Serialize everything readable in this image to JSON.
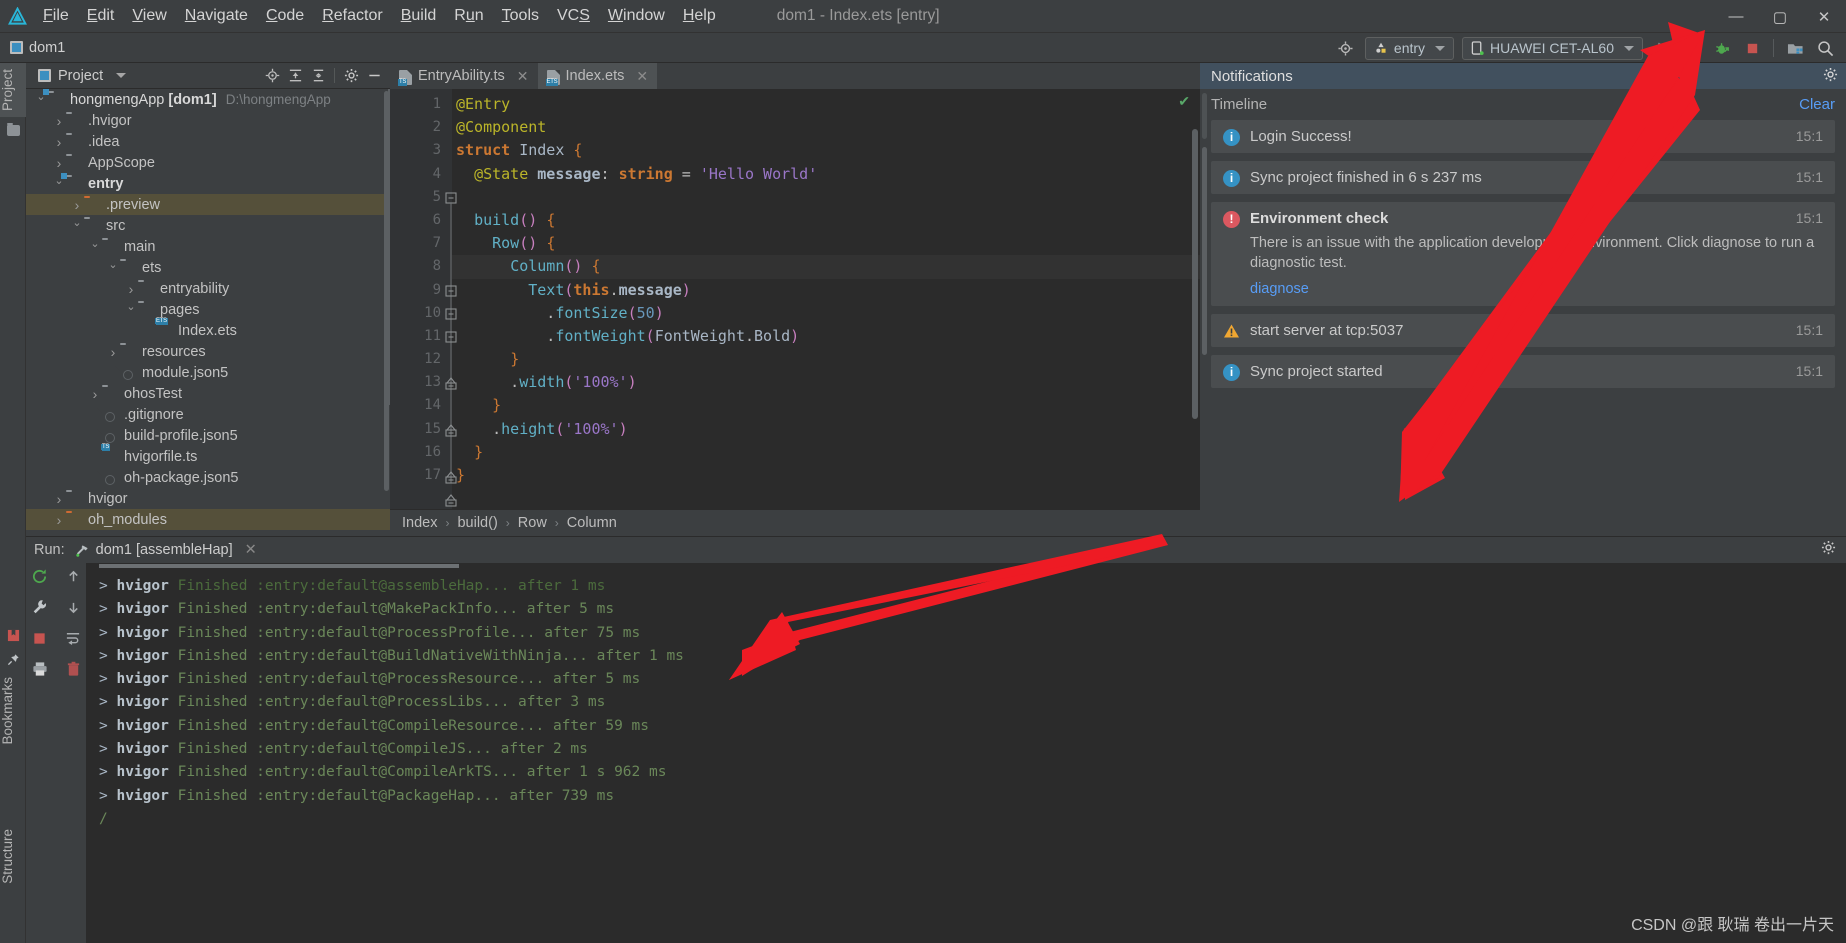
{
  "window": {
    "title": "dom1 - Index.ets [entry]",
    "minimize": "—",
    "maximize": "▢",
    "close": "✕"
  },
  "menubar": {
    "logo_icon": "deveco-logo-icon",
    "items": [
      {
        "label": "File"
      },
      {
        "label": "Edit"
      },
      {
        "label": "View"
      },
      {
        "label": "Navigate"
      },
      {
        "label": "Code"
      },
      {
        "label": "Refactor"
      },
      {
        "label": "Build"
      },
      {
        "label": "Run"
      },
      {
        "label": "Tools"
      },
      {
        "label": "VCS"
      },
      {
        "label": "Window"
      },
      {
        "label": "Help"
      }
    ]
  },
  "toolbar": {
    "project_label": "dom1",
    "target_icon": "target-icon",
    "run_config": "entry",
    "device": "HUAWEI CET-AL60",
    "run_icon": "run-icon",
    "debug_icon": "debug-icon",
    "attach_debug_icon": "attach-debugger-icon",
    "stop_icon": "stop-icon",
    "device_manager_icon": "device-manager-icon",
    "search_icon": "search-icon"
  },
  "left_strip": {
    "project_tab": "Project",
    "folder_icon": "folder-icon",
    "bookmarks_tab": "Bookmarks",
    "structure_tab": "Structure",
    "bookmark_icons": [
      "bookmark-square-icon",
      "pin-icon"
    ]
  },
  "project_panel": {
    "title": "Project",
    "icons": [
      "locate-icon",
      "expand-all-icon",
      "collapse-all-icon",
      "settings-gear-icon",
      "hide-icon"
    ],
    "tree": [
      {
        "label": "hongmengApp [dom1]",
        "path": "D:\\hongmengApp",
        "indent": 0,
        "arrow": "open",
        "icon": "module-folder-icon",
        "bold": true
      },
      {
        "label": ".hvigor",
        "indent": 1,
        "arrow": "closed",
        "icon": "folder-icon"
      },
      {
        "label": ".idea",
        "indent": 1,
        "arrow": "closed",
        "icon": "folder-icon"
      },
      {
        "label": "AppScope",
        "indent": 1,
        "arrow": "closed",
        "icon": "folder-icon"
      },
      {
        "label": "entry",
        "indent": 1,
        "arrow": "open",
        "icon": "module-folder-icon",
        "bold": true
      },
      {
        "label": ".preview",
        "indent": 2,
        "arrow": "closed",
        "icon": "excluded-folder-icon",
        "selected": true
      },
      {
        "label": "src",
        "indent": 2,
        "arrow": "open",
        "icon": "folder-icon"
      },
      {
        "label": "main",
        "indent": 3,
        "arrow": "open",
        "icon": "folder-icon"
      },
      {
        "label": "ets",
        "indent": 4,
        "arrow": "open",
        "icon": "folder-icon"
      },
      {
        "label": "entryability",
        "indent": 5,
        "arrow": "closed",
        "icon": "folder-icon"
      },
      {
        "label": "pages",
        "indent": 5,
        "arrow": "open",
        "icon": "folder-icon"
      },
      {
        "label": "Index.ets",
        "indent": 6,
        "arrow": "none",
        "icon": "ets-file-icon"
      },
      {
        "label": "resources",
        "indent": 4,
        "arrow": "closed",
        "icon": "folder-icon"
      },
      {
        "label": "module.json5",
        "indent": 4,
        "arrow": "none",
        "icon": "json5-file-icon"
      },
      {
        "label": "ohosTest",
        "indent": 3,
        "arrow": "closed",
        "icon": "folder-icon"
      },
      {
        "label": ".gitignore",
        "indent": 3,
        "arrow": "none",
        "icon": "gitignore-file-icon"
      },
      {
        "label": "build-profile.json5",
        "indent": 3,
        "arrow": "none",
        "icon": "json5-file-icon"
      },
      {
        "label": "hvigorfile.ts",
        "indent": 3,
        "arrow": "none",
        "icon": "ts-file-icon"
      },
      {
        "label": "oh-package.json5",
        "indent": 3,
        "arrow": "none",
        "icon": "json5-file-icon"
      },
      {
        "label": "hvigor",
        "indent": 1,
        "arrow": "closed",
        "icon": "folder-icon"
      },
      {
        "label": "oh_modules",
        "indent": 1,
        "arrow": "closed",
        "icon": "excluded-folder-icon",
        "selected": true
      }
    ]
  },
  "editor": {
    "tabs": [
      {
        "label": "EntryAbility.ts",
        "icon": "ts-file-icon",
        "active": false,
        "close": "✕"
      },
      {
        "label": "Index.ets",
        "icon": "ets-file-icon",
        "active": true,
        "close": "✕"
      }
    ],
    "line_numbers": [
      "1",
      "2",
      "3",
      "4",
      "5",
      "6",
      "7",
      "8",
      "9",
      "10",
      "11",
      "12",
      "13",
      "14",
      "15",
      "16",
      "17"
    ],
    "code_lines": [
      "@Entry",
      "@Component",
      "struct Index {",
      "  @State message: string = 'Hello World'",
      "",
      "  build() {",
      "    Row() {",
      "      Column() {",
      "        Text(this.message)",
      "          .fontSize(50)",
      "          .fontWeight(FontWeight.Bold)",
      "      }",
      "      .width('100%')",
      "    }",
      "    .height('100%')",
      "  }",
      "}"
    ],
    "inspection_status": "✔",
    "breadcrumb": [
      "Index",
      "build()",
      "Row",
      "Column"
    ],
    "breadcrumb_separator": "›"
  },
  "notifications": {
    "title": "Notifications",
    "gear_icon": "settings-gear-icon",
    "timeline_label": "Timeline",
    "clear_all": "Clear",
    "items": [
      {
        "severity": "info",
        "title": "Login Success!",
        "time": "15:1",
        "body": "",
        "link": ""
      },
      {
        "severity": "info",
        "title": "Sync project finished in 6 s 237 ms",
        "time": "15:1",
        "body": "",
        "link": ""
      },
      {
        "severity": "error",
        "title": "Environment check",
        "time": "15:1",
        "body": "There is an issue with the application development environment. Click diagnose to run a diagnostic test.",
        "link": "diagnose"
      },
      {
        "severity": "warn",
        "title": "start server at tcp:5037",
        "time": "15:1",
        "body": "",
        "link": ""
      },
      {
        "severity": "info",
        "title": "Sync project started",
        "time": "15:1",
        "body": "",
        "link": ""
      }
    ]
  },
  "run_panel": {
    "label": "Run:",
    "tab": "dom1 [assembleHap]",
    "tab_icon": "hammer-icon",
    "tab_close": "✕",
    "gear_icon": "settings-gear-icon",
    "side_icons": [
      "rerun-icon",
      "scroll-up-icon",
      "wrench-icon",
      "scroll-down-icon",
      "stop-icon",
      "soft-wrap-icon",
      "print-icon",
      "trash-icon"
    ],
    "console_lines": [
      {
        "prefix": "> ",
        "tool": "hvigor",
        "text": " Finished :entry:default@assembleHap... after 1 ms",
        "partial": true
      },
      {
        "prefix": "> ",
        "tool": "hvigor",
        "text": " Finished :entry:default@MakePackInfo... after 5 ms"
      },
      {
        "prefix": "> ",
        "tool": "hvigor",
        "text": " Finished :entry:default@ProcessProfile... after 75 ms"
      },
      {
        "prefix": "> ",
        "tool": "hvigor",
        "text": " Finished :entry:default@BuildNativeWithNinja... after 1 ms"
      },
      {
        "prefix": "> ",
        "tool": "hvigor",
        "text": " Finished :entry:default@ProcessResource... after 5 ms"
      },
      {
        "prefix": "> ",
        "tool": "hvigor",
        "text": " Finished :entry:default@ProcessLibs... after 3 ms"
      },
      {
        "prefix": "> ",
        "tool": "hvigor",
        "text": " Finished :entry:default@CompileResource... after 59 ms"
      },
      {
        "prefix": "> ",
        "tool": "hvigor",
        "text": " Finished :entry:default@CompileJS... after 2 ms"
      },
      {
        "prefix": "> ",
        "tool": "hvigor",
        "text": " Finished :entry:default@CompileArkTS... after 1 s 962 ms"
      },
      {
        "prefix": "> ",
        "tool": "hvigor",
        "text": " Finished :entry:default@PackageHap... after 739 ms"
      },
      {
        "prefix": "",
        "tool": "",
        "text": "/"
      }
    ]
  },
  "watermark": "CSDN @跟 耿瑞 卷出一片天",
  "annotations": {
    "arrow_color": "#ee1b24",
    "arrow_count": 2
  },
  "colors": {
    "accent": "#3592c4",
    "error": "#db5860",
    "warn": "#f0a732",
    "success": "#59a869",
    "link": "#589df6",
    "editor_bg": "#2b2b2b",
    "panel_bg": "#3c3f41",
    "selection": "#55503a"
  }
}
